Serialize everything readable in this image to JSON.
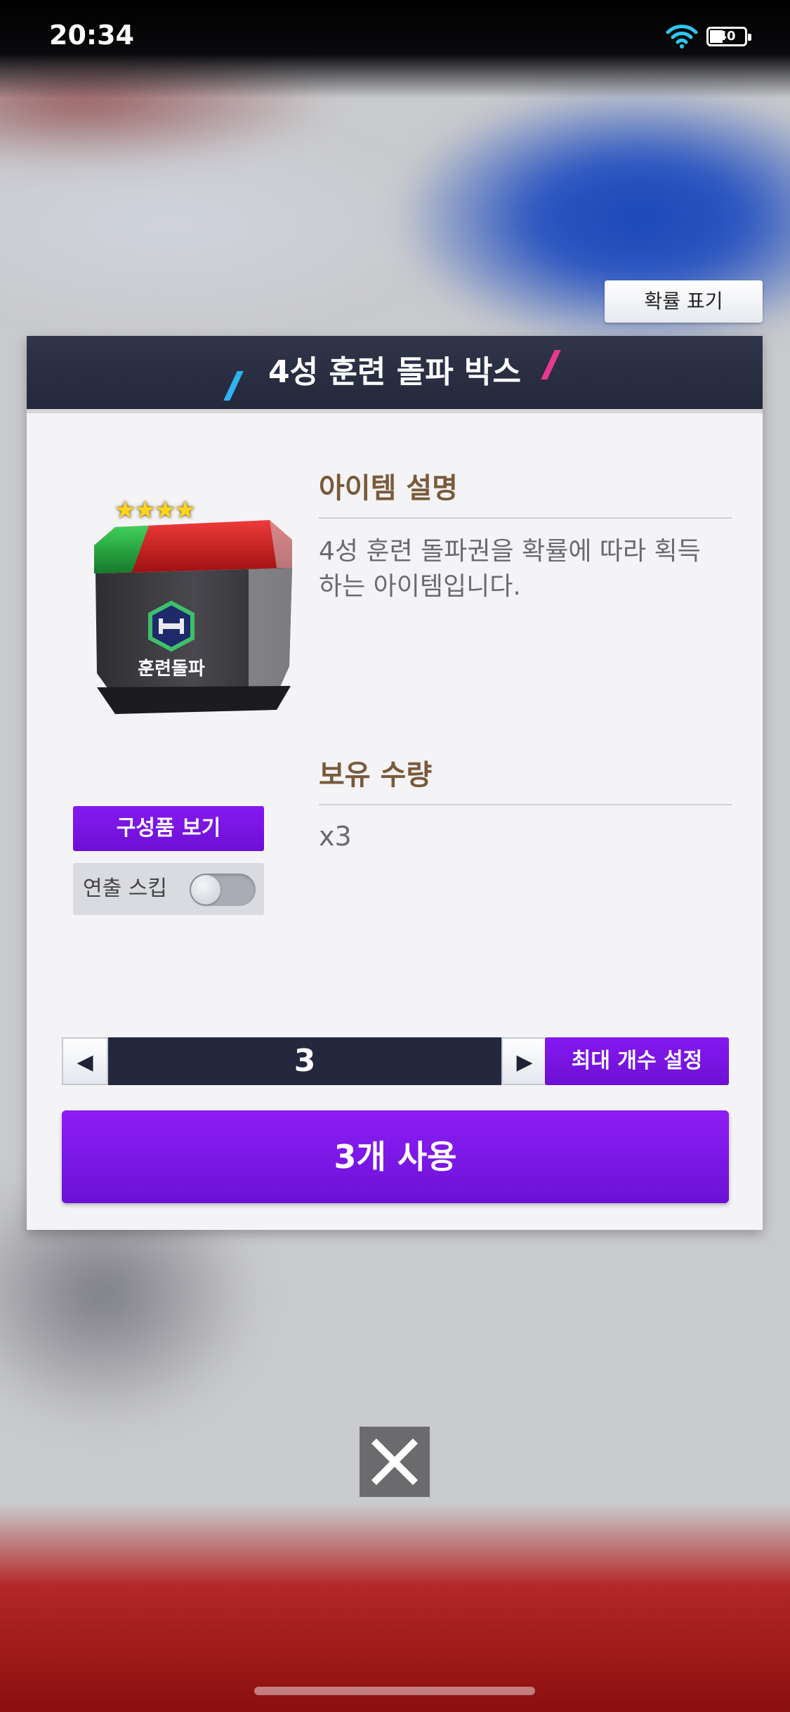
{
  "status_bar": {
    "time": "20:34",
    "battery_level": "40"
  },
  "probability_button": {
    "label": "확률 표기"
  },
  "dialog": {
    "title": "4성 훈련 돌파 박스",
    "item": {
      "star_count": 4,
      "image_label": "훈련돌파"
    },
    "composition_button": {
      "label": "구성품 보기"
    },
    "skip_toggle": {
      "label": "연출 스킵",
      "on": false
    },
    "description": {
      "heading": "아이템 설명",
      "text": "4성 훈련 돌파권을 확률에 따라 획득하는 아이템입니다."
    },
    "owned": {
      "heading": "보유 수량",
      "value": "x3"
    },
    "quantity_stepper": {
      "value": "3"
    },
    "max_button": {
      "label": "최대 개수 설정"
    },
    "use_button": {
      "label": "3개 사용"
    }
  },
  "colors": {
    "accent_purple": "#7a14e6",
    "header_navy": "#282d40",
    "heading_brown": "#7a5a3a"
  }
}
